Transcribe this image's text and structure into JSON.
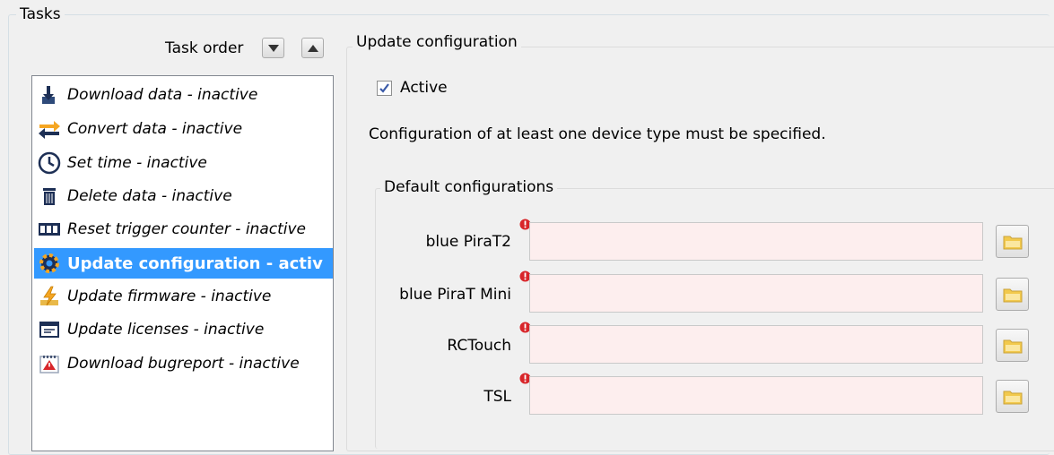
{
  "tasks_group": {
    "title": "Tasks"
  },
  "task_order": {
    "label": "Task order",
    "down_icon": "arrow-down-icon",
    "up_icon": "arrow-up-icon"
  },
  "tasks": [
    {
      "label": "Download data - inactive",
      "icon": "download-icon",
      "selected": false
    },
    {
      "label": "Convert data - inactive",
      "icon": "convert-icon",
      "selected": false
    },
    {
      "label": "Set time - inactive",
      "icon": "clock-icon",
      "selected": false
    },
    {
      "label": "Delete data - inactive",
      "icon": "trash-icon",
      "selected": false
    },
    {
      "label": "Reset trigger counter - inactive",
      "icon": "counter-icon",
      "selected": false
    },
    {
      "label": "Update configuration - activ",
      "icon": "gear-icon",
      "selected": true
    },
    {
      "label": "Update firmware - inactive",
      "icon": "firmware-bolt-icon",
      "selected": false
    },
    {
      "label": "Update licenses - inactive",
      "icon": "license-icon",
      "selected": false
    },
    {
      "label": "Download bugreport - inactive",
      "icon": "bugreport-icon",
      "selected": false
    }
  ],
  "update_config": {
    "title": "Update configuration",
    "active_label": "Active",
    "active_checked": true,
    "info": "Configuration of at least one device type must be specified.",
    "defaults_title": "Default configurations",
    "devices": [
      {
        "label": "blue PiraT2",
        "value": ""
      },
      {
        "label": "blue PiraT Mini",
        "value": ""
      },
      {
        "label": "RCTouch",
        "value": ""
      },
      {
        "label": "TSL",
        "value": ""
      }
    ]
  },
  "colors": {
    "selection": "#3399ff",
    "input_error_bg": "#fdeeee",
    "error_icon": "#d8262a",
    "folder": "#f2c94c"
  }
}
